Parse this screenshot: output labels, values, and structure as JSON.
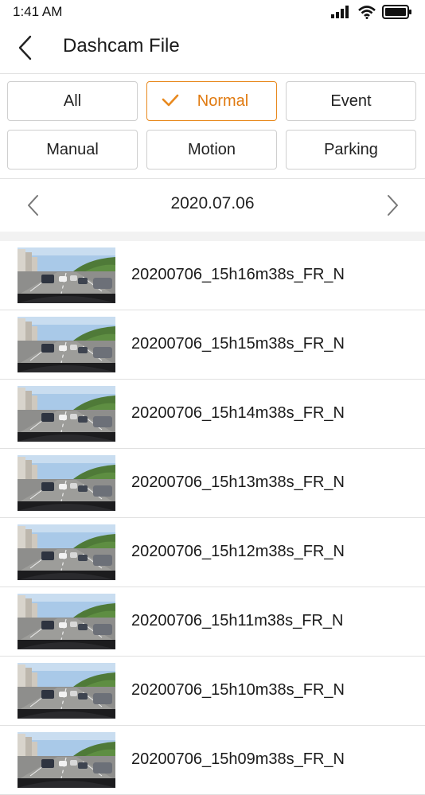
{
  "status": {
    "time": "1:41 AM"
  },
  "header": {
    "title": "Dashcam File"
  },
  "filters": [
    {
      "label": "All",
      "active": false
    },
    {
      "label": "Normal",
      "active": true
    },
    {
      "label": "Event",
      "active": false
    },
    {
      "label": "Manual",
      "active": false
    },
    {
      "label": "Motion",
      "active": false
    },
    {
      "label": "Parking",
      "active": false
    }
  ],
  "date": {
    "label": "2020.07.06"
  },
  "files": [
    {
      "name": "20200706_15h16m38s_FR_N"
    },
    {
      "name": "20200706_15h15m38s_FR_N"
    },
    {
      "name": "20200706_15h14m38s_FR_N"
    },
    {
      "name": "20200706_15h13m38s_FR_N"
    },
    {
      "name": "20200706_15h12m38s_FR_N"
    },
    {
      "name": "20200706_15h11m38s_FR_N"
    },
    {
      "name": "20200706_15h10m38s_FR_N"
    },
    {
      "name": "20200706_15h09m38s_FR_N"
    }
  ],
  "colors": {
    "accent": "#e8891e"
  }
}
